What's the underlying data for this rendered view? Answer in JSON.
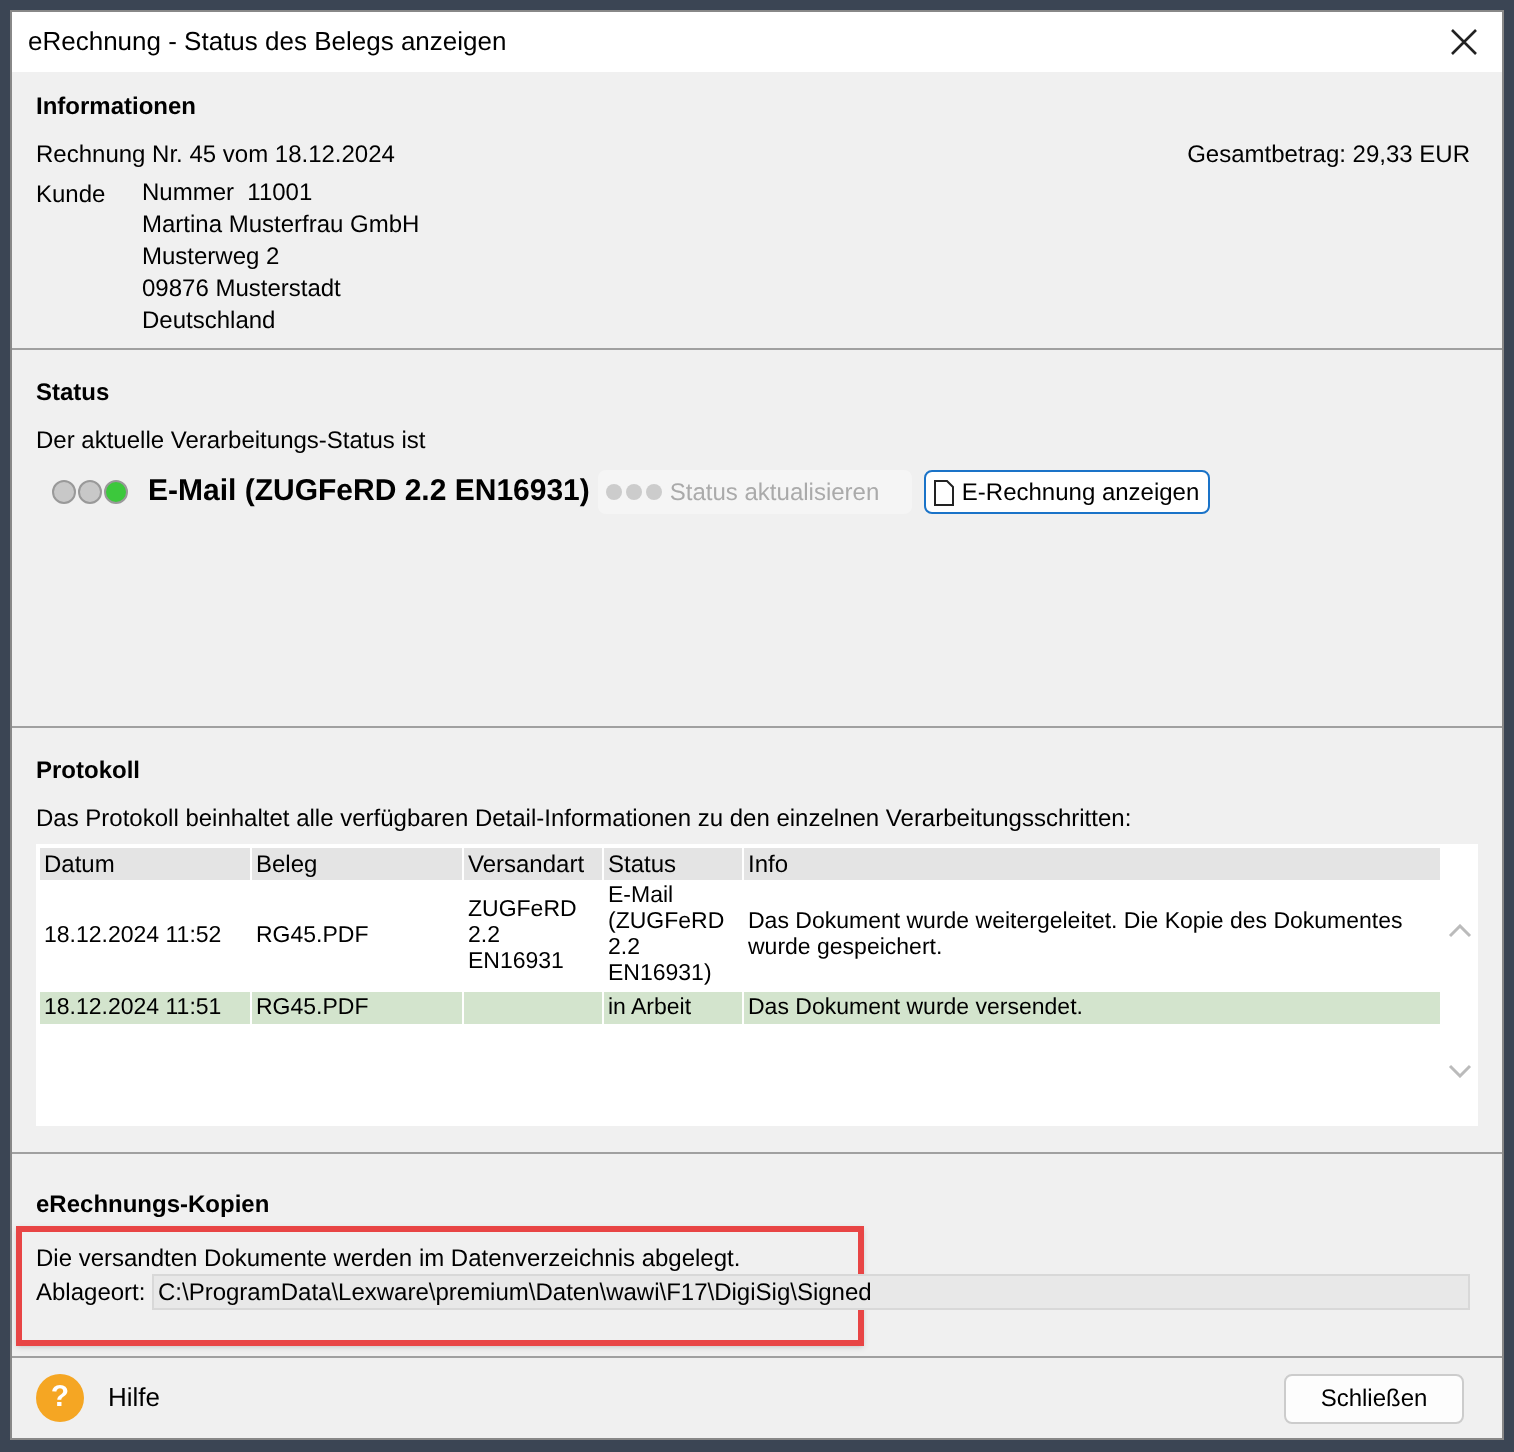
{
  "window": {
    "title": "eRechnung - Status des Belegs anzeigen"
  },
  "informationen": {
    "heading": "Informationen",
    "invoice": "Rechnung Nr. 45 vom 18.12.2024",
    "total": "Gesamtbetrag: 29,33 EUR",
    "customer_label": "Kunde",
    "customer_lines": [
      "Nummer  11001",
      "Martina Musterfrau GmbH",
      "Musterweg 2",
      "09876 Musterstadt",
      "Deutschland"
    ]
  },
  "status": {
    "heading": "Status",
    "intro": "Der aktuelle Verarbeitungs-Status ist",
    "lights": [
      {
        "color": "#c8c8c8"
      },
      {
        "color": "#c8c8c8"
      },
      {
        "color": "#3cc83c"
      }
    ],
    "value": "E-Mail (ZUGFeRD 2.2 EN16931)",
    "refresh_button": {
      "label": "Status aktualisieren",
      "disabled": true
    },
    "show_button": {
      "label": "E-Rechnung anzeigen"
    }
  },
  "protokoll": {
    "heading": "Protokoll",
    "intro": "Das Protokoll beinhaltet alle verfügbaren Detail-Informationen zu den einzelnen Verarbeitungsschritten:",
    "table": {
      "columns": [
        "Datum",
        "Beleg",
        "Versandart",
        "Status",
        "Info"
      ],
      "rows": [
        {
          "selected": false,
          "cells": [
            "18.12.2024 11:52",
            "RG45.PDF",
            "ZUGFeRD 2.2 EN16931",
            "E-Mail (ZUGFeRD 2.2 EN16931)",
            "Das Dokument wurde weitergeleitet. Die Kopie des Dokumentes wurde gespeichert."
          ]
        },
        {
          "selected": true,
          "cells": [
            "18.12.2024 11:51",
            "RG45.PDF",
            "",
            "in Arbeit",
            "Das Dokument wurde versendet."
          ]
        }
      ]
    }
  },
  "kopien": {
    "heading": "eRechnungs-Kopien",
    "intro": "Die versandten Dokumente werden im Datenverzeichnis abgelegt.",
    "path_label": "Ablageort:",
    "path_value": "C:\\ProgramData\\Lexware\\premium\\Daten\\wawi\\F17\\DigiSig\\Signed"
  },
  "footer": {
    "help_icon": "?",
    "help": "Hilfe",
    "close_button": "Schließen"
  }
}
